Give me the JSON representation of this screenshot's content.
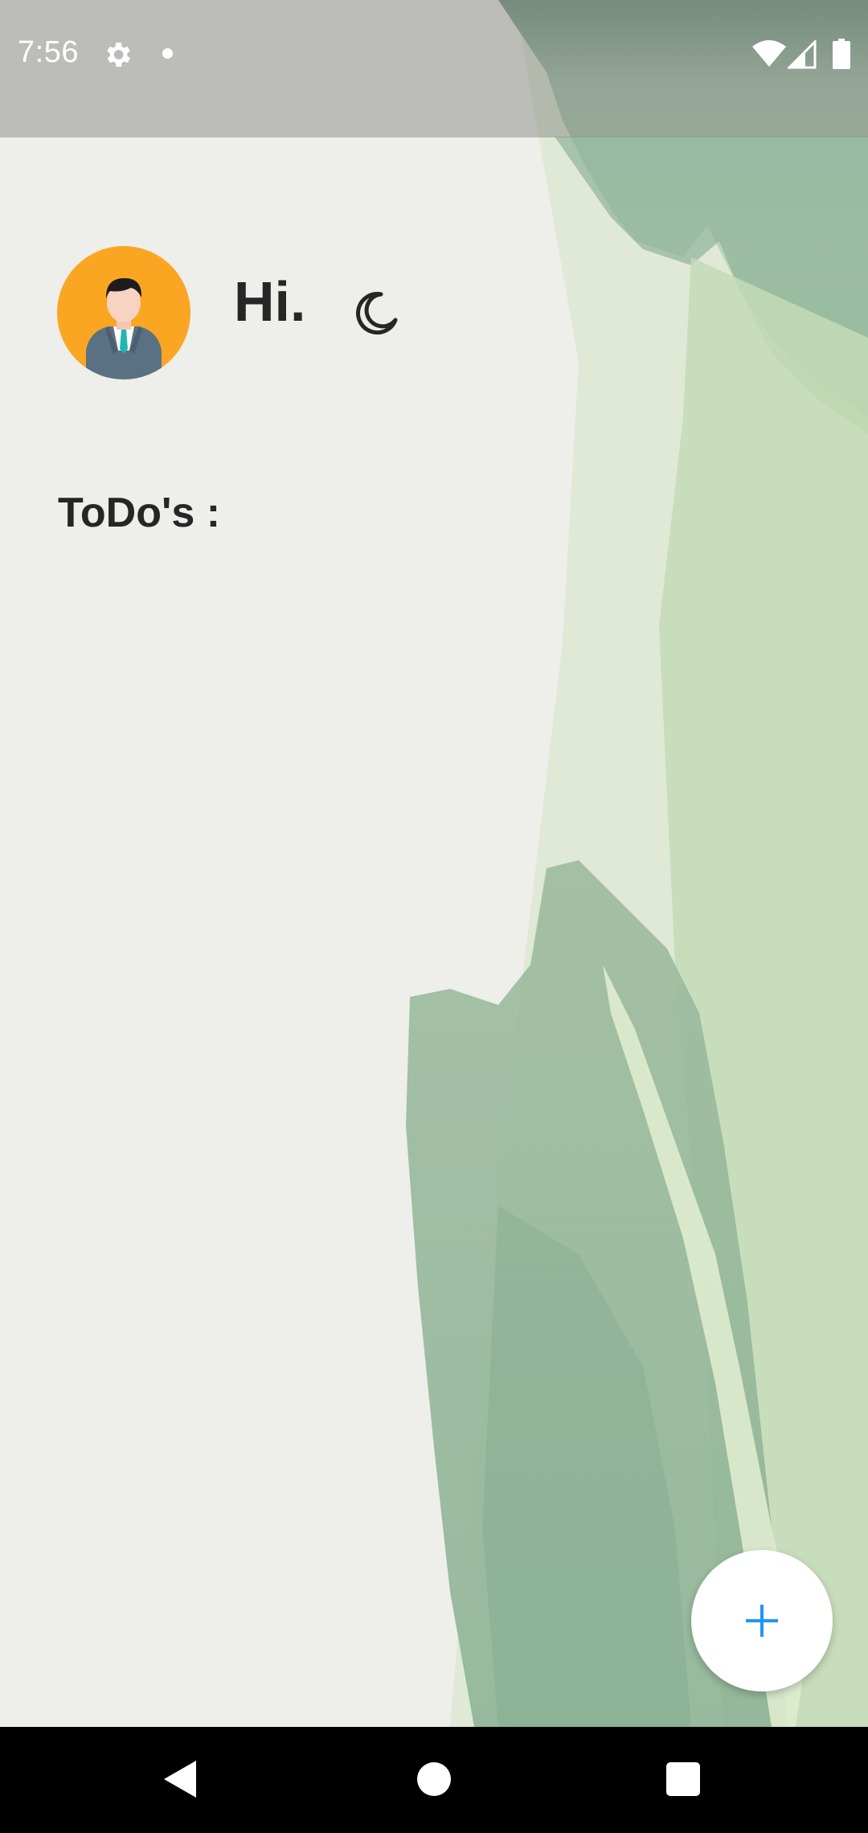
{
  "status_bar": {
    "time": "7:56",
    "icons": [
      "gear-icon",
      "notification-dot-icon",
      "wifi-icon",
      "cell-signal-icon",
      "battery-icon"
    ]
  },
  "header": {
    "avatar_icon": "businessman-avatar-icon",
    "greeting": "Hi.",
    "theme_toggle_icon": "moon-icon"
  },
  "todos": {
    "title": "ToDo's :",
    "items": []
  },
  "fab": {
    "icon": "plus-icon",
    "icon_color": "#2196f3"
  },
  "nav_bar": {
    "icons": [
      "back-icon",
      "home-icon",
      "recents-icon"
    ]
  },
  "colors": {
    "avatar_bg": "#fba623",
    "text": "#262626",
    "accent": "#2196f3",
    "paint_green": "#8fb99a"
  }
}
